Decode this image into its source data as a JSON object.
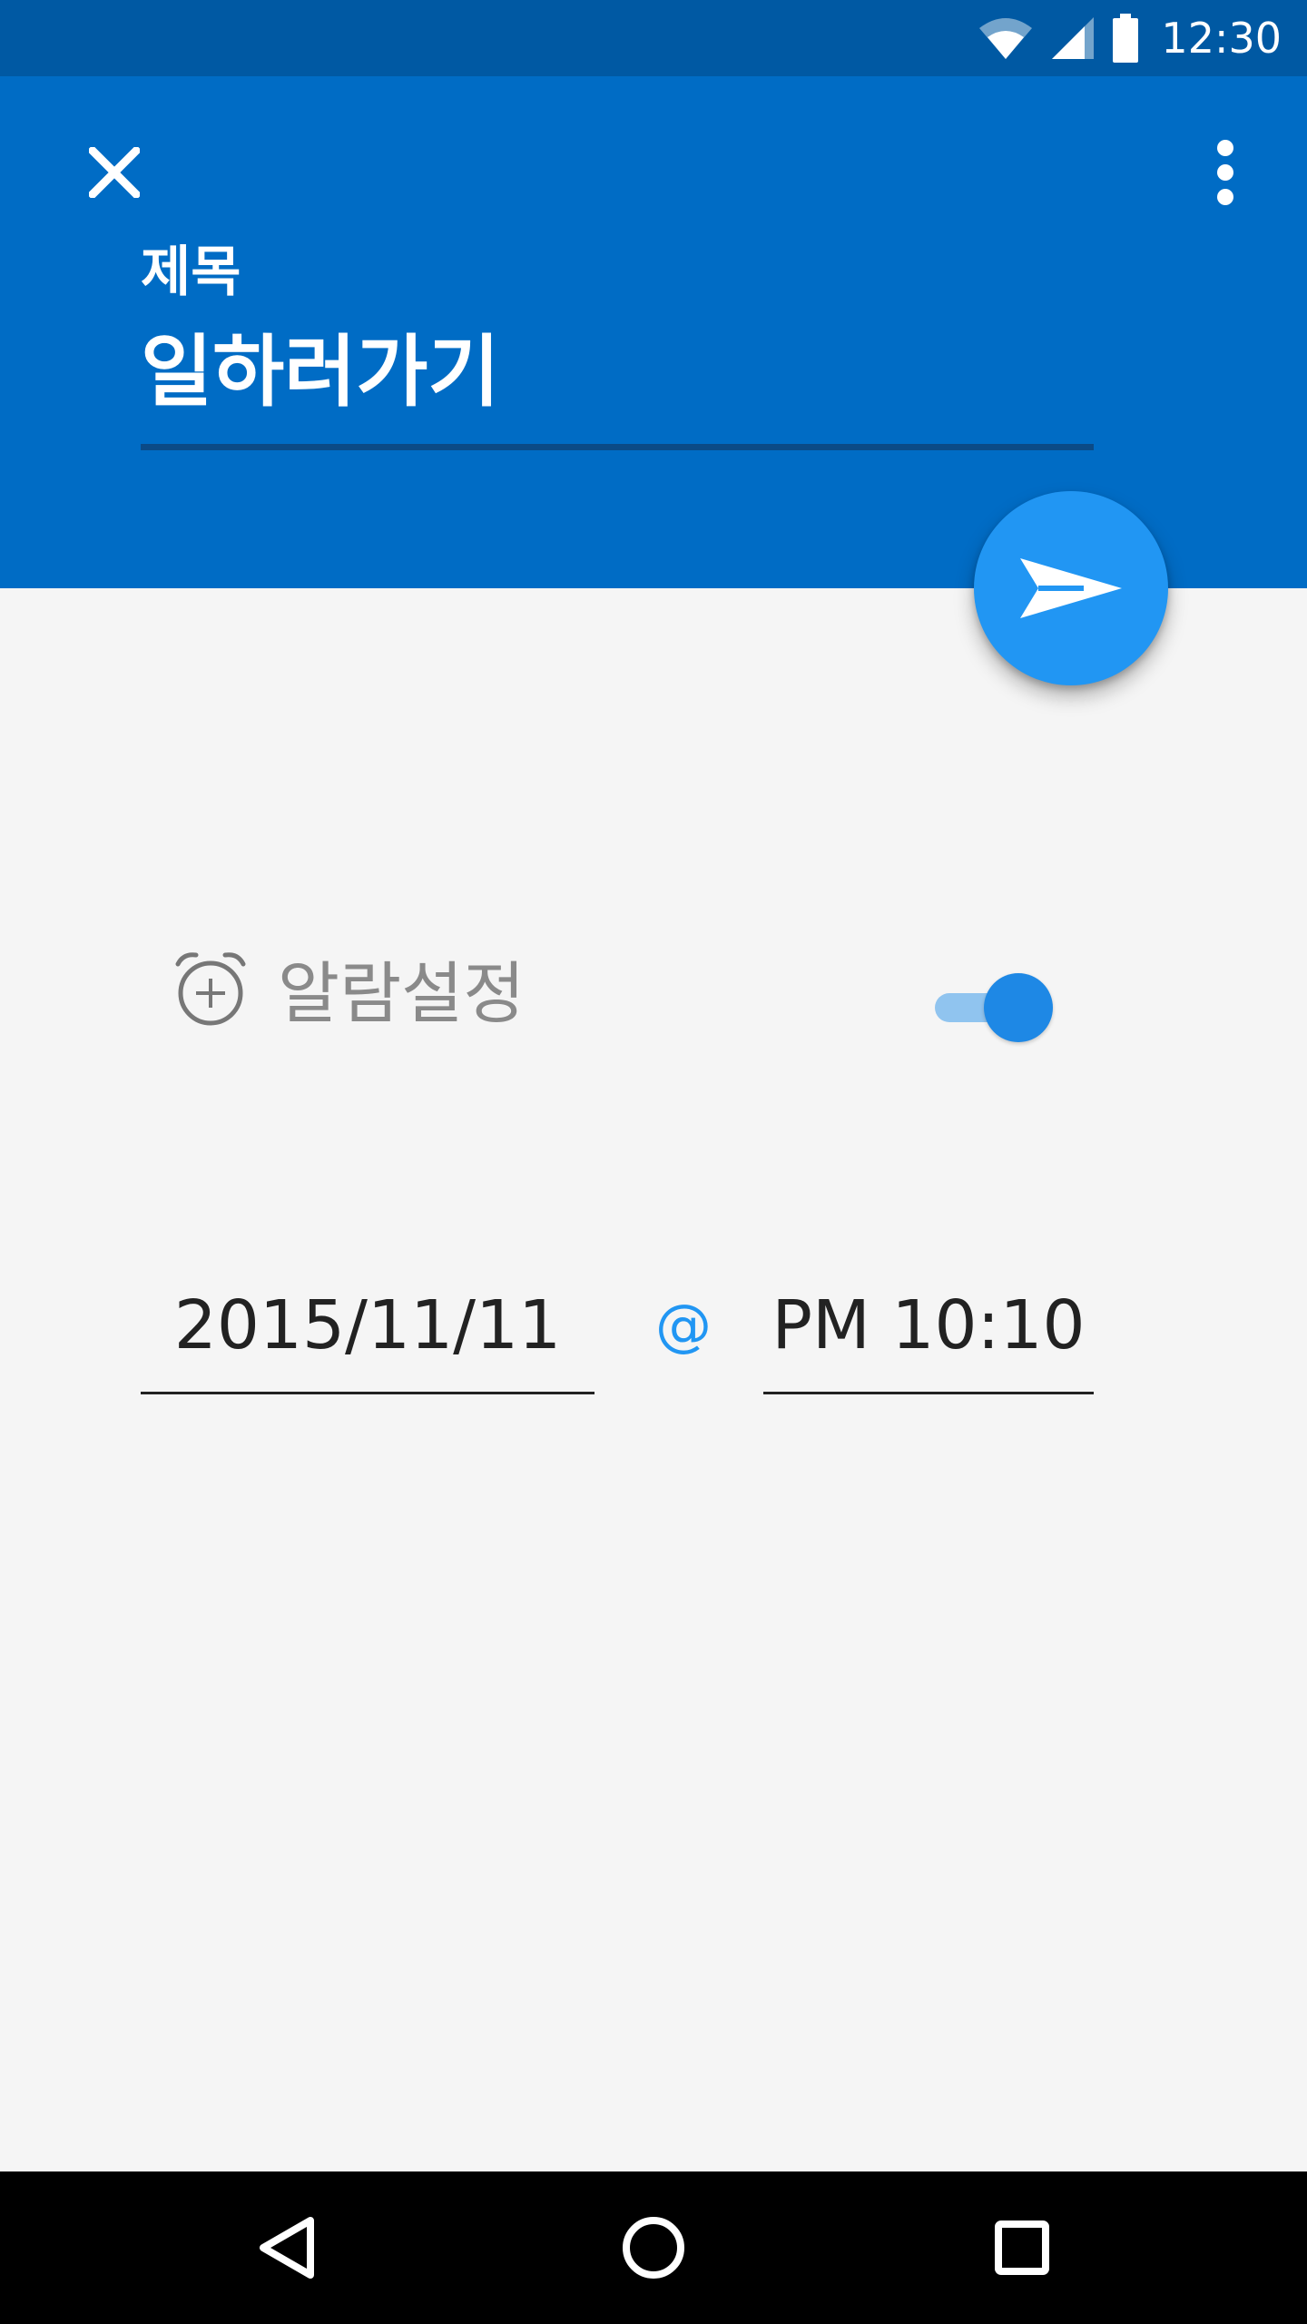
{
  "status_bar": {
    "time": "12:30",
    "icons": [
      "wifi-icon",
      "cellular-signal-icon",
      "battery-icon"
    ],
    "background_color": "#0059a3"
  },
  "header": {
    "background_color": "#006cc5",
    "close_icon": "close-icon",
    "more_icon": "more-vertical-icon",
    "title_label": "제목",
    "title_value": "일하러가기"
  },
  "fab": {
    "icon": "send-icon",
    "color": "#2196f3"
  },
  "alarm": {
    "icon": "alarm-add-icon",
    "label": "알람설정",
    "enabled": true,
    "accent_color": "#1e88e5"
  },
  "schedule": {
    "date": "2015/11/11",
    "separator": "@",
    "time": "PM 10:10"
  },
  "nav_bar": {
    "buttons": [
      "back-icon",
      "home-icon",
      "recents-icon"
    ]
  }
}
